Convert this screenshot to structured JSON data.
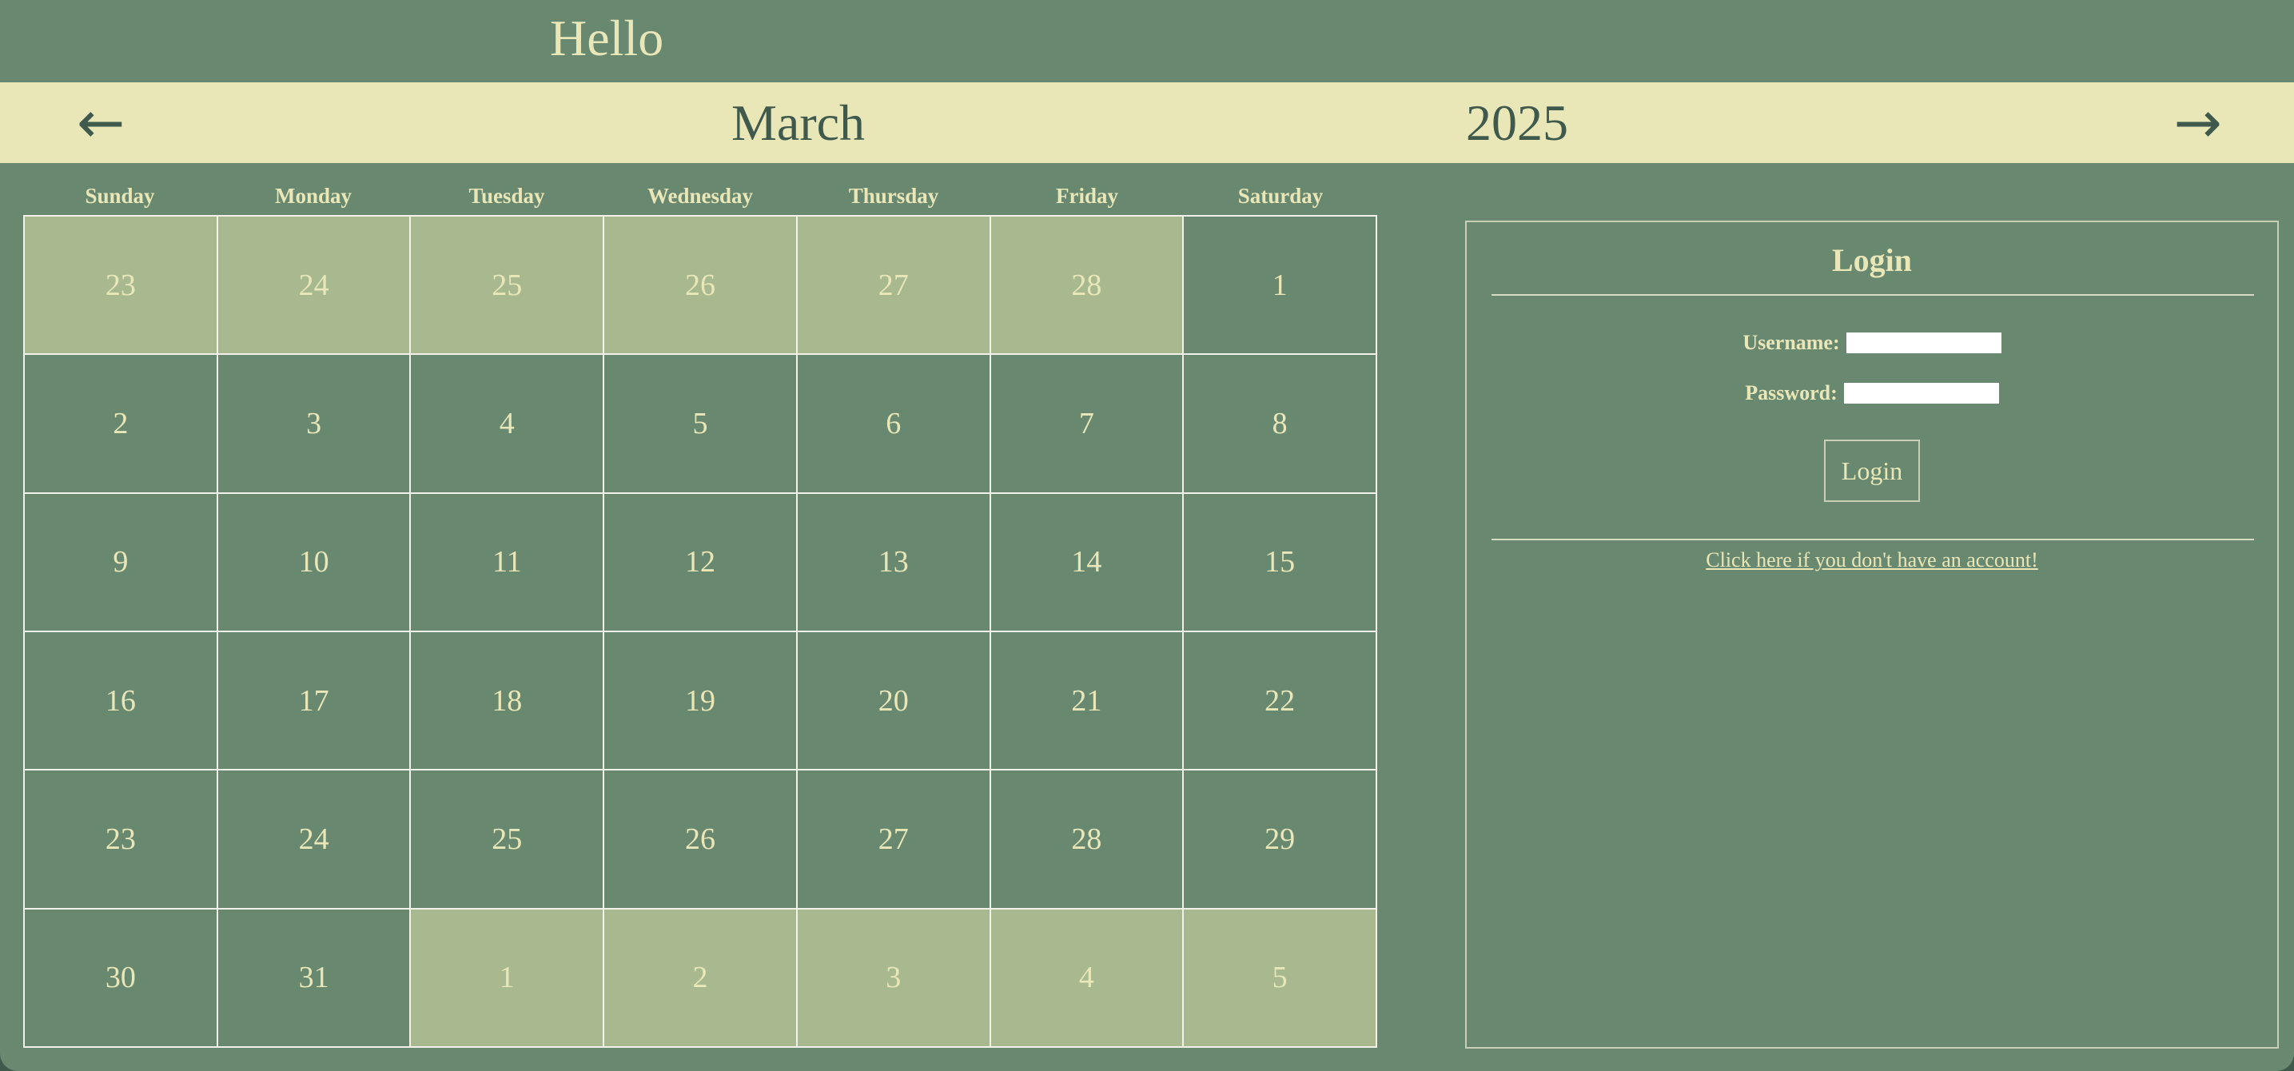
{
  "header": {
    "greeting": "Hello"
  },
  "month_bar": {
    "prev_arrow": "←",
    "next_arrow": "→",
    "month": "March",
    "year": "2025"
  },
  "calendar": {
    "weekdays": [
      "Sunday",
      "Monday",
      "Tuesday",
      "Wednesday",
      "Thursday",
      "Friday",
      "Saturday"
    ],
    "days": [
      {
        "label": "23",
        "other_month": true
      },
      {
        "label": "24",
        "other_month": true
      },
      {
        "label": "25",
        "other_month": true
      },
      {
        "label": "26",
        "other_month": true
      },
      {
        "label": "27",
        "other_month": true
      },
      {
        "label": "28",
        "other_month": true
      },
      {
        "label": "1",
        "other_month": false
      },
      {
        "label": "2",
        "other_month": false
      },
      {
        "label": "3",
        "other_month": false
      },
      {
        "label": "4",
        "other_month": false
      },
      {
        "label": "5",
        "other_month": false
      },
      {
        "label": "6",
        "other_month": false
      },
      {
        "label": "7",
        "other_month": false
      },
      {
        "label": "8",
        "other_month": false
      },
      {
        "label": "9",
        "other_month": false
      },
      {
        "label": "10",
        "other_month": false
      },
      {
        "label": "11",
        "other_month": false
      },
      {
        "label": "12",
        "other_month": false
      },
      {
        "label": "13",
        "other_month": false
      },
      {
        "label": "14",
        "other_month": false
      },
      {
        "label": "15",
        "other_month": false
      },
      {
        "label": "16",
        "other_month": false
      },
      {
        "label": "17",
        "other_month": false
      },
      {
        "label": "18",
        "other_month": false
      },
      {
        "label": "19",
        "other_month": false
      },
      {
        "label": "20",
        "other_month": false
      },
      {
        "label": "21",
        "other_month": false
      },
      {
        "label": "22",
        "other_month": false
      },
      {
        "label": "23",
        "other_month": false
      },
      {
        "label": "24",
        "other_month": false
      },
      {
        "label": "25",
        "other_month": false
      },
      {
        "label": "26",
        "other_month": false
      },
      {
        "label": "27",
        "other_month": false
      },
      {
        "label": "28",
        "other_month": false
      },
      {
        "label": "29",
        "other_month": false
      },
      {
        "label": "30",
        "other_month": false
      },
      {
        "label": "31",
        "other_month": false
      },
      {
        "label": "1",
        "other_month": true
      },
      {
        "label": "2",
        "other_month": true
      },
      {
        "label": "3",
        "other_month": true
      },
      {
        "label": "4",
        "other_month": true
      },
      {
        "label": "5",
        "other_month": true
      }
    ]
  },
  "login": {
    "title": "Login",
    "username_label": "Username:",
    "username_value": "",
    "password_label": "Password:",
    "password_value": "",
    "button_label": "Login",
    "signup_link": "Click here if you don't have an account!"
  },
  "colors": {
    "background": "#698870",
    "cream": "#e9e7b8",
    "other_month_cell": "#a8b990",
    "dark_green_text": "#3f5a4c"
  }
}
